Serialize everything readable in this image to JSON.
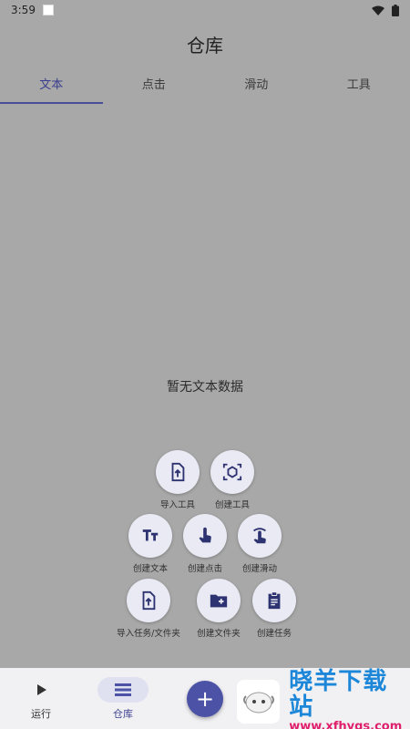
{
  "status": {
    "time": "3:59"
  },
  "header": {
    "title": "仓库"
  },
  "tabs": [
    {
      "label": "文本",
      "active": true
    },
    {
      "label": "点击",
      "active": false
    },
    {
      "label": "滑动",
      "active": false
    },
    {
      "label": "工具",
      "active": false
    }
  ],
  "main": {
    "empty_text": "暂无文本数据"
  },
  "fab_menu": {
    "import_tool": {
      "label": "导入工具",
      "icon": "upload-file-icon"
    },
    "create_tool": {
      "label": "创建工具",
      "icon": "cube-scan-icon"
    },
    "create_text": {
      "label": "创建文本",
      "icon": "text-tt-icon"
    },
    "create_click": {
      "label": "创建点击",
      "icon": "tap-finger-icon"
    },
    "create_swipe": {
      "label": "创建滑动",
      "icon": "swipe-finger-icon"
    },
    "import_task": {
      "label": "导入任务/文件夹",
      "icon": "upload-file-icon"
    },
    "create_folder": {
      "label": "创建文件夹",
      "icon": "folder-plus-icon"
    },
    "create_task": {
      "label": "创建任务",
      "icon": "clipboard-icon"
    }
  },
  "bottom_nav": {
    "run": {
      "label": "运行",
      "icon": "play-icon"
    },
    "repo": {
      "label": "仓库",
      "icon": "list-icon",
      "active": true
    },
    "fab": {
      "label": "+"
    }
  },
  "watermark": {
    "title": "晓羊下载站",
    "url": "www.xfhygs.com"
  },
  "colors": {
    "accent": "#4c53a6",
    "fab_bg": "#e9eaf3",
    "scrim": "#a8a8a8"
  }
}
